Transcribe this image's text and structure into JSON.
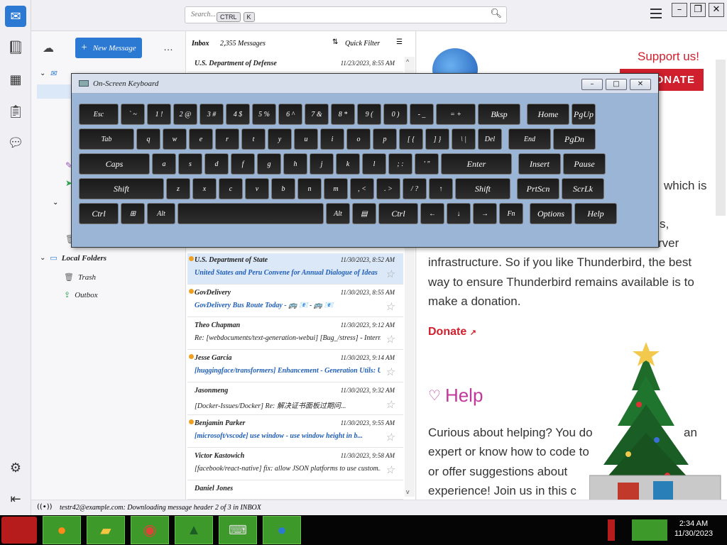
{
  "toolbar": {
    "search_placeholder": "Search...",
    "kbd1": "CTRL",
    "kbd2": "K",
    "search_icon": "magnifier-icon",
    "menu_icon": "hamburger-icon"
  },
  "window_controls": {
    "minimize": "–",
    "maximize": "❐",
    "close": "✕"
  },
  "spaces": [
    "mail-icon",
    "address-book-icon",
    "calendar-icon",
    "tasks-icon",
    "chat-icon"
  ],
  "folder_pane": {
    "new_message": "New Message",
    "more": "…",
    "local_folders": "Local Folders",
    "trash": "Trash",
    "outbox": "Outbox"
  },
  "thread_pane": {
    "header_left": "Inbox",
    "header_count": "2,355 Messages",
    "quick_filter": "Quick Filter",
    "messages": [
      {
        "from": "U.S. Department of Defense",
        "date": "11/23/2023, 8:55 AM",
        "subject": "",
        "unread": false,
        "selected": false
      },
      {
        "from": "U.S. Department of State",
        "date": "11/30/2023, 8:52 AM",
        "subject": "United States and Peru Convene for Annual Dialogue of Ideas",
        "unread": true,
        "selected": true
      },
      {
        "from": "GovDelivery",
        "date": "11/30/2023, 8:55 AM",
        "subject": "GovDelivery Bus Route Today - 🚌 📧 - 🚌 📧",
        "unread": true,
        "selected": false
      },
      {
        "from": "Theo Chapman",
        "date": "11/30/2023, 9:12 AM",
        "subject": "Re: [webdocuments/text-generation-webui] [Bug_/stress] - Internally in...",
        "unread": false,
        "selected": false,
        "plain": true
      },
      {
        "from": "Jesse Garcia",
        "date": "11/30/2023, 9:14 AM",
        "subject": "[huggingface/transformers] Enhancement - Generation Utils: Update...",
        "unread": true,
        "selected": false
      },
      {
        "from": "Jasonmeng",
        "date": "11/30/2023, 9:32 AM",
        "subject": "[Docker-Issues/Docker] Re: 解决证书面板过期问...",
        "unread": false,
        "selected": false,
        "plain": true
      },
      {
        "from": "Benjamin Parker",
        "date": "11/30/2023, 9:55 AM",
        "subject": "[microsoft/vscode] use window - use window height in b...",
        "unread": true,
        "selected": false
      },
      {
        "from": "Victor Kastowich",
        "date": "11/30/2023, 9:58 AM",
        "subject": "[facebook/react-native] fix: allow JSON platforms to use custom...",
        "unread": false,
        "selected": false,
        "plain": true
      },
      {
        "from": "Daniel Jones",
        "date": "",
        "subject": "",
        "unread": false,
        "selected": false
      }
    ]
  },
  "content": {
    "support": "Support us!",
    "donate_btn": "DONATE",
    "para1_tail_a": "which is",
    "para1_tail_b": "s,",
    "para1_tail_c": "rver",
    "para1_rest": "infrastructure. So if you like Thunderbird, the best way to ensure Thunderbird remains available is to make a donation.",
    "donate_link": "Donate",
    "help_heading": "Help",
    "para2": "Curious about helping? You do",
    "para2b": "an",
    "para2c": "expert or know how to code to",
    "para2d": "or offer suggestions about",
    "para2e": "experience! Join us in this c"
  },
  "status_bar": {
    "text": "testr42@example.com: Downloading message header 2 of 3 in INBOX"
  },
  "osk": {
    "title": "On-Screen Keyboard",
    "rows": [
      [
        "Esc",
        "` ~",
        "1 !",
        "2 @",
        "3 #",
        "4 $",
        "5 %",
        "6 ^",
        "7 &",
        "8 *",
        "9 (",
        "0 )",
        "- _",
        "= +",
        "Bksp",
        "Home",
        "PgUp"
      ],
      [
        "Tab",
        "q",
        "w",
        "e",
        "r",
        "t",
        "y",
        "u",
        "i",
        "o",
        "p",
        "[ {",
        "] }",
        "\\ |",
        "Del",
        "End",
        "PgDn"
      ],
      [
        "Caps",
        "a",
        "s",
        "d",
        "f",
        "g",
        "h",
        "j",
        "k",
        "l",
        "; :",
        "' \"",
        "Enter",
        "Insert",
        "Pause"
      ],
      [
        "Shift",
        "z",
        "x",
        "c",
        "v",
        "b",
        "n",
        "m",
        ", <",
        ". >",
        "/ ?",
        "↑",
        "Shift",
        "PrtScn",
        "ScrLk"
      ],
      [
        "Ctrl",
        "⊞",
        "Alt",
        "",
        "Alt",
        "▤",
        "Ctrl",
        "←",
        "↓",
        "→",
        "Fn",
        "Options",
        "Help"
      ]
    ]
  },
  "taskbar": {
    "time": "2:34 AM",
    "date": "11/30/2023"
  }
}
